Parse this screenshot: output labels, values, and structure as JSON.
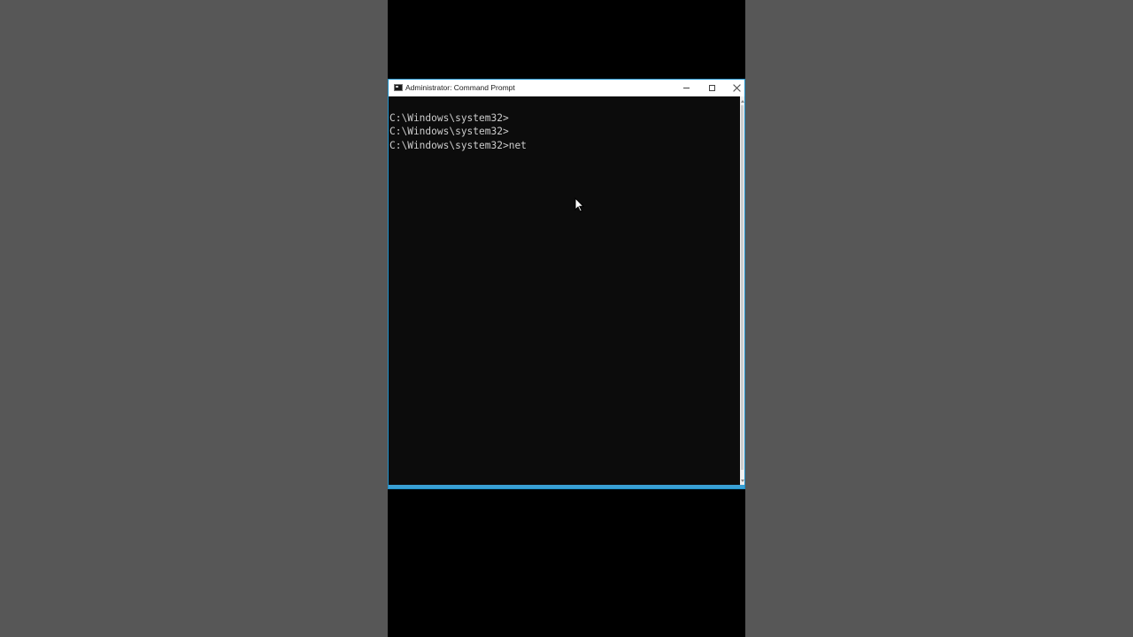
{
  "window": {
    "title": "Administrator: Command Prompt",
    "icon": "cmd-icon",
    "accent": "#1e90c8"
  },
  "controls": {
    "minimize_icon": "minimize-icon",
    "maximize_icon": "maximize-icon",
    "close_icon": "close-icon"
  },
  "console": {
    "lines": [
      "C:\\Windows\\system32>",
      "C:\\Windows\\system32>",
      "C:\\Windows\\system32>net"
    ],
    "background": "#0c0c0c",
    "foreground": "#cccccc"
  },
  "pointer": {
    "icon": "mouse-pointer-icon"
  }
}
